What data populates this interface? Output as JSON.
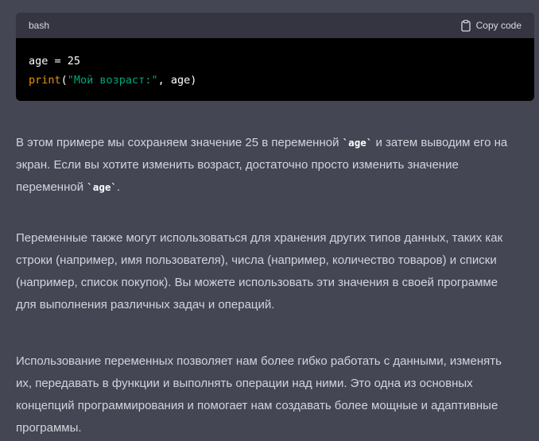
{
  "code_block": {
    "language": "bash",
    "copy_label": "Copy code",
    "line1": "age = 25",
    "line2_fn": "print",
    "line2_open": "(",
    "line2_str": "\"Мой возраст:\"",
    "line2_rest": ", age)"
  },
  "paragraphs": [
    {
      "lines": [
        [
          "В этом примере мы сохраняем значение 25 в переменной ",
          "`age`",
          " и затем выводим его на"
        ],
        [
          "экран. Если вы хотите изменить возраст, достаточно просто изменить значение"
        ],
        [
          "переменной ",
          "`age`",
          "."
        ]
      ]
    },
    {
      "lines": [
        [
          "Переменные также могут использоваться для хранения других типов данных, таких как"
        ],
        [
          "строки (например, имя пользователя), числа (например, количество товаров) и списки"
        ],
        [
          "(например, список покупок). Вы можете использовать эти значения в своей программе"
        ],
        [
          "для выполнения различных задач и операций."
        ]
      ]
    },
    {
      "lines": [
        [
          "Использование переменных позволяет нам более гибко работать с данными, изменять"
        ],
        [
          "их, передавать в функции и выполнять операции над ними. Это одна из основных"
        ],
        [
          "концепций программирования и помогает нам создавать более мощные и адаптивные"
        ],
        [
          "программы."
        ]
      ]
    }
  ]
}
